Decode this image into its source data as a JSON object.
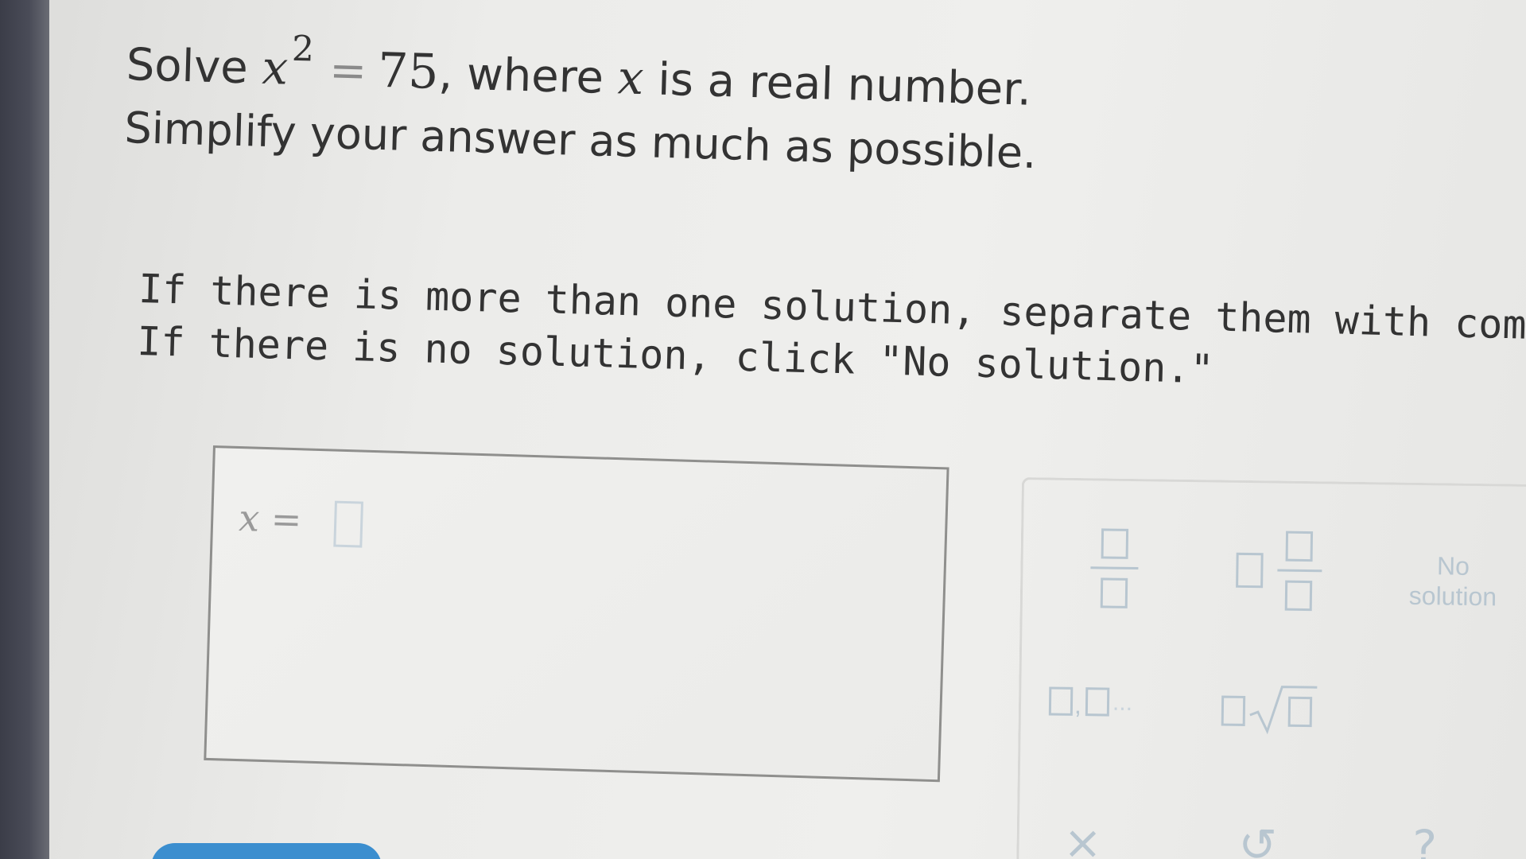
{
  "question": {
    "solve_word": "Solve",
    "var": "x",
    "exponent": "2",
    "equals": "=",
    "rhs": "75",
    "where_text": ", where",
    "real_text": "is a real number.",
    "line2": "Simplify your answer as much as possible."
  },
  "instructions": {
    "line1": "If there is more than one solution, separate them with commas.",
    "line2": "If there is no solution, click \"No solution.\""
  },
  "answer": {
    "var": "x",
    "equals": "=",
    "value": ""
  },
  "keypad": {
    "no_solution_line1": "No",
    "no_solution_line2": "solution",
    "list_comma": ",",
    "list_dots": "...",
    "clear_symbol": "×",
    "undo_symbol": "↺",
    "help_symbol": "?"
  },
  "colors": {
    "text": "#333333",
    "keypad_icon": "#b8c6d0",
    "submit_blue": "#3b8ecf"
  }
}
